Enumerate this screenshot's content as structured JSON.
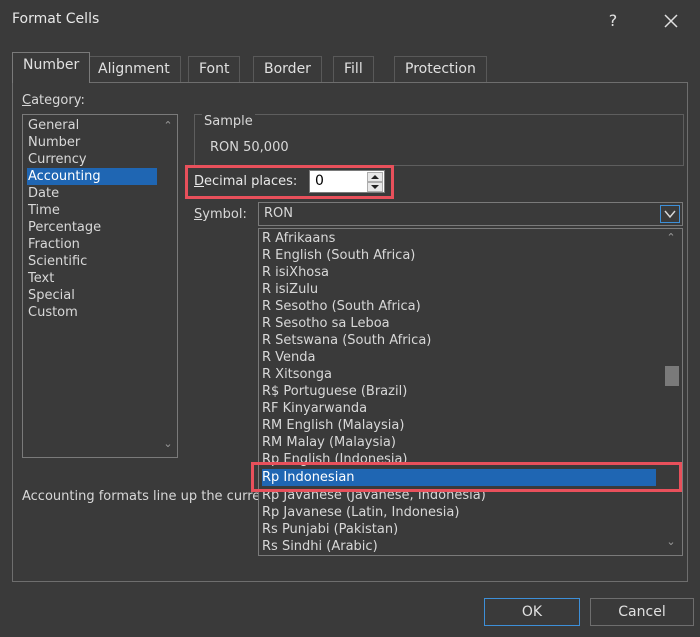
{
  "window": {
    "title": "Format Cells",
    "help_label": "?"
  },
  "tabs": [
    {
      "label": "Number"
    },
    {
      "label": "Alignment"
    },
    {
      "label": "Font"
    },
    {
      "label": "Border"
    },
    {
      "label": "Fill"
    },
    {
      "label": "Protection"
    }
  ],
  "category": {
    "label_hot": "C",
    "label_rest": "ategory:",
    "items": [
      "General",
      "Number",
      "Currency",
      "Accounting",
      "Date",
      "Time",
      "Percentage",
      "Fraction",
      "Scientific",
      "Text",
      "Special",
      "Custom"
    ],
    "selected": "Accounting"
  },
  "sample": {
    "label": "Sample",
    "value": "RON 50,000"
  },
  "decimal_places": {
    "label_hot": "D",
    "label_rest": "ecimal places:",
    "value": "0"
  },
  "symbol": {
    "label_hot": "S",
    "label_rest": "ymbol:",
    "value": "RON",
    "options": [
      "R Afrikaans",
      "R English (South Africa)",
      "R isiXhosa",
      "R isiZulu",
      "R Sesotho (South Africa)",
      "R Sesotho sa Leboa",
      "R Setswana (South Africa)",
      "R Venda",
      "R Xitsonga",
      "R$ Portuguese (Brazil)",
      "RF Kinyarwanda",
      "RM English (Malaysia)",
      "RM Malay (Malaysia)",
      "Rp English (Indonesia)",
      "Rp Indonesian",
      "Rp Javanese (Javanese, Indonesia)",
      "Rp Javanese (Latin, Indonesia)",
      "Rs Punjabi (Pakistan)",
      "Rs Sindhi (Arabic)"
    ],
    "selected": "Rp Indonesian"
  },
  "description": "Accounting formats line up the currency symbols and decimal points in a column.",
  "buttons": {
    "ok": "OK",
    "cancel": "Cancel"
  },
  "colors": {
    "highlight": "#e8505b",
    "selection": "#1f66b3",
    "focus": "#3d8fd8"
  }
}
